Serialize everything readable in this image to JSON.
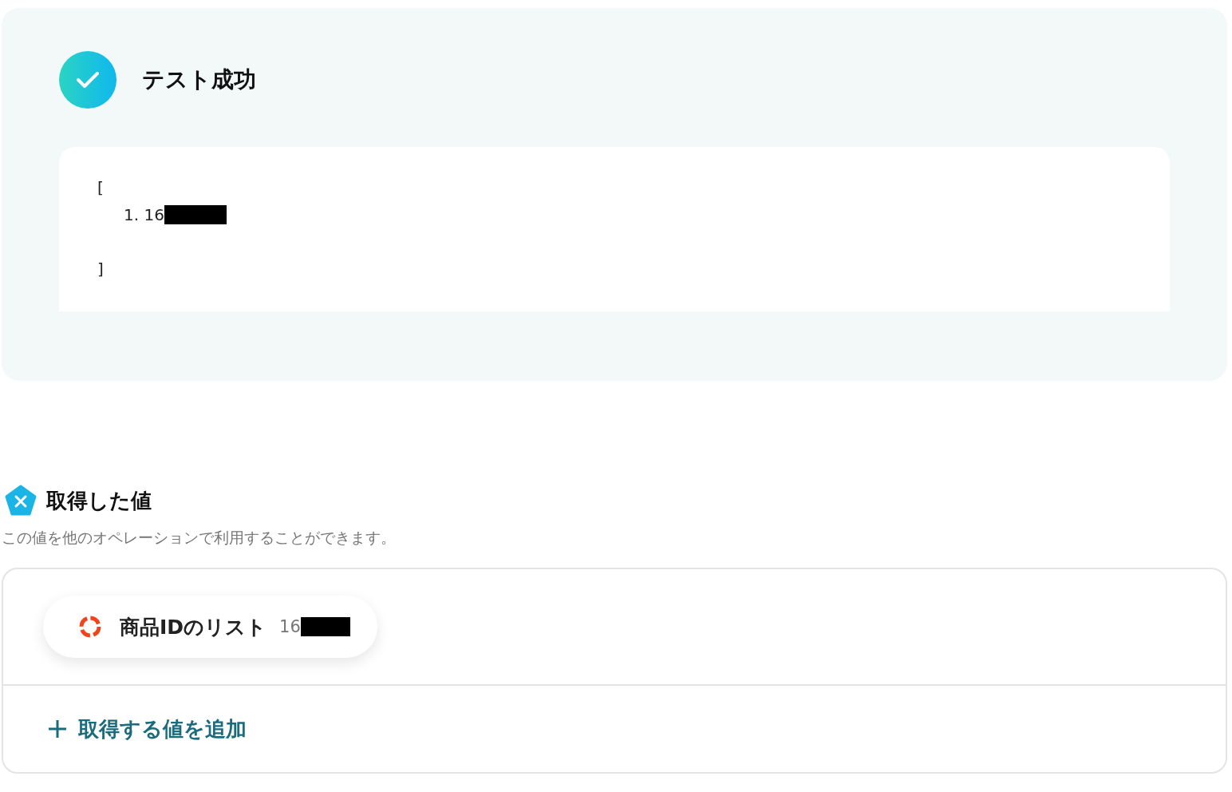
{
  "test_result": {
    "title": "テスト成功",
    "success": true,
    "output": {
      "open": "[",
      "items": [
        {
          "number": "1.",
          "value": "16",
          "redacted": true
        }
      ],
      "close": "]"
    }
  },
  "obtained_values": {
    "title": "取得した値",
    "description": "この値を他のオペレーションで利用することができます。",
    "values": [
      {
        "name": "商品IDのリスト",
        "value": "16",
        "redacted": true
      }
    ],
    "add_button": "取得する値を追加"
  }
}
